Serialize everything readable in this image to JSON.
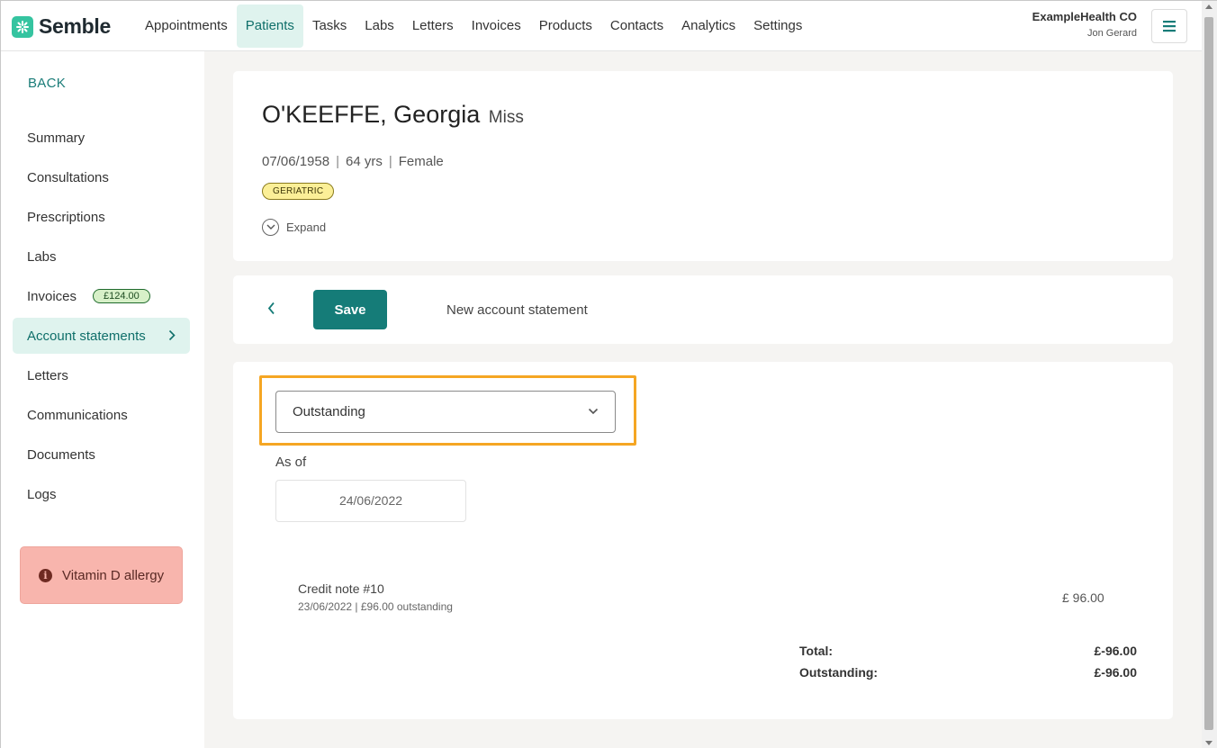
{
  "brand": {
    "name": "Semble",
    "accent": "#35c4a0",
    "primary": "#157c78"
  },
  "nav": {
    "items": [
      {
        "label": "Appointments",
        "active": false
      },
      {
        "label": "Patients",
        "active": true
      },
      {
        "label": "Tasks",
        "active": false
      },
      {
        "label": "Labs",
        "active": false
      },
      {
        "label": "Letters",
        "active": false
      },
      {
        "label": "Invoices",
        "active": false
      },
      {
        "label": "Products",
        "active": false
      },
      {
        "label": "Contacts",
        "active": false
      },
      {
        "label": "Analytics",
        "active": false
      },
      {
        "label": "Settings",
        "active": false
      }
    ]
  },
  "account": {
    "org": "ExampleHealth CO",
    "user": "Jon Gerard"
  },
  "sidebar": {
    "back_label": "BACK",
    "items": [
      {
        "label": "Summary"
      },
      {
        "label": "Consultations"
      },
      {
        "label": "Prescriptions"
      },
      {
        "label": "Labs"
      },
      {
        "label": "Invoices",
        "badge": "£124.00"
      },
      {
        "label": "Account statements",
        "active": true
      },
      {
        "label": "Letters"
      },
      {
        "label": "Communications"
      },
      {
        "label": "Documents"
      },
      {
        "label": "Logs"
      }
    ],
    "alert": {
      "icon": "info-icon",
      "text": "Vitamin D allergy"
    }
  },
  "patient": {
    "name": "O'KEEFFE, Georgia",
    "title": "Miss",
    "dob": "07/06/1958",
    "age": "64 yrs",
    "sex": "Female",
    "tag": "GERIATRIC",
    "expand_label": "Expand"
  },
  "toolbar": {
    "save_label": "Save",
    "title": "New account statement"
  },
  "statement": {
    "type_selected": "Outstanding",
    "as_of_label": "As of",
    "as_of_date": "24/06/2022",
    "lines": [
      {
        "title": "Credit note #10",
        "subtitle": "23/06/2022 | £96.00 outstanding",
        "amount": "£ 96.00"
      }
    ],
    "total_label": "Total:",
    "total_value": "£-96.00",
    "outstanding_label": "Outstanding:",
    "outstanding_value": "£-96.00"
  }
}
